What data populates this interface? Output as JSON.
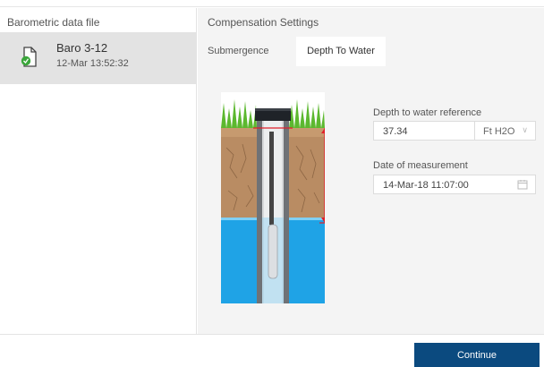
{
  "left_panel": {
    "title": "Barometric data file",
    "files": [
      {
        "name": "Baro 3-12",
        "date": "12-Mar 13:52:32"
      }
    ]
  },
  "right_panel": {
    "title": "Compensation Settings",
    "tabs": [
      {
        "label": "Submergence",
        "selected": false
      },
      {
        "label": "Depth To Water",
        "selected": true
      }
    ],
    "depth_reference": {
      "label": "Depth to water reference",
      "value": "37.34",
      "unit": "Ft H2O"
    },
    "measurement_date": {
      "label": "Date of measurement",
      "value": "14-Mar-18 11:07:00"
    }
  },
  "footer": {
    "continue_label": "Continue"
  },
  "colors": {
    "accent": "#0b4a7f",
    "water": "#1fa3e6",
    "marker": "#e0202a",
    "file_icon": "#3aa63a"
  }
}
